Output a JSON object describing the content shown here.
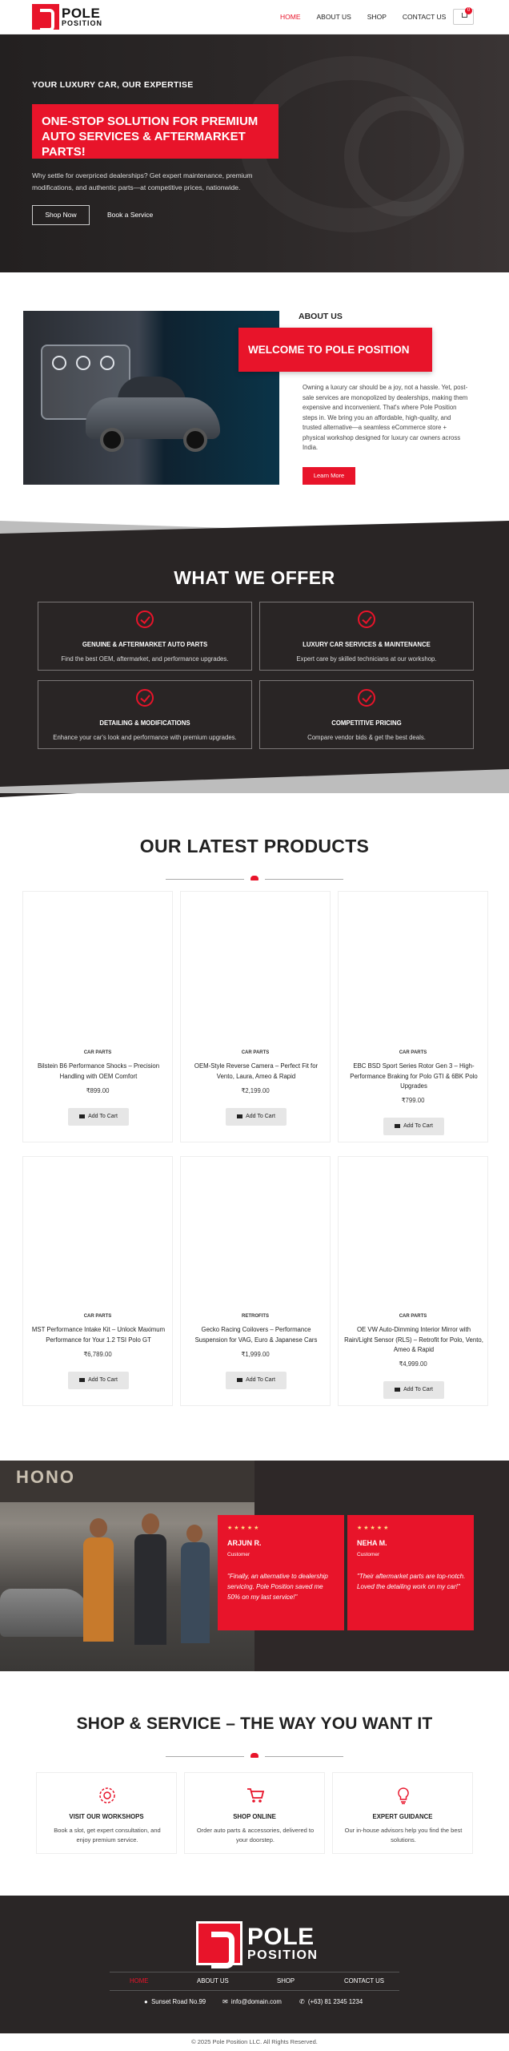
{
  "header": {
    "logo_line1": "POLE",
    "logo_line2": "POSITION",
    "nav": [
      "HOME",
      "ABOUT US",
      "SHOP",
      "CONTACT US"
    ],
    "cart_count": "0"
  },
  "hero": {
    "tagline": "YOUR LUXURY CAR, OUR EXPERTISE",
    "headline": "ONE-STOP SOLUTION FOR PREMIUM AUTO SERVICES & AFTERMARKET PARTS!",
    "subtext": "Why settle for overpriced dealerships? Get expert maintenance, premium modifications, and authentic parts—at competitive prices, nationwide.",
    "btn_shop": "Shop Now",
    "btn_service": "Book a Service"
  },
  "about": {
    "heading": "ABOUT US",
    "welcome": "WELCOME TO POLE POSITION",
    "paragraph": "Owning a luxury car should be a joy, not a hassle. Yet, post-sale services are monopolized by dealerships, making them expensive and inconvenient. That's where Pole Position steps in. We bring you an affordable, high-quality, and trusted alternative—a seamless eCommerce store + physical workshop designed for luxury car owners across India.",
    "btn": "Learn More"
  },
  "offer": {
    "heading": "WHAT WE OFFER",
    "cards": [
      {
        "title": "GENUINE & AFTERMARKET AUTO PARTS",
        "desc": "Find the best OEM, aftermarket, and performance upgrades."
      },
      {
        "title": "LUXURY CAR SERVICES & MAINTENANCE",
        "desc": "Expert care by skilled technicians at our workshop."
      },
      {
        "title": "DETAILING & MODIFICATIONS",
        "desc": "Enhance your car's look and performance with premium upgrades."
      },
      {
        "title": "COMPETITIVE PRICING",
        "desc": "Compare vendor bids & get the best deals."
      }
    ]
  },
  "products": {
    "heading": "OUR LATEST PRODUCTS",
    "add_label": "Add To Cart",
    "items": [
      {
        "cat": "CAR PARTS",
        "name": "Bilstein B6 Performance Shocks – Precision Handling with OEM Comfort",
        "price": "₹899.00"
      },
      {
        "cat": "CAR PARTS",
        "name": "OEM-Style Reverse Camera – Perfect Fit for Vento, Laura, Ameo & Rapid",
        "price": "₹2,199.00"
      },
      {
        "cat": "CAR PARTS",
        "name": "EBC BSD Sport Series Rotor Gen 3 – High-Performance Braking for Polo GTI & 6BK Polo Upgrades",
        "price": "₹799.00"
      },
      {
        "cat": "CAR PARTS",
        "name": "MST Performance Intake Kit – Unlock Maximum Performance for Your 1.2 TSI Polo GT",
        "price": "₹6,789.00"
      },
      {
        "cat": "RETROFITS",
        "name": "Gecko Racing Coilovers – Performance Suspension for VAG, Euro & Japanese Cars",
        "price": "₹1,999.00"
      },
      {
        "cat": "CAR PARTS",
        "name": "OE VW Auto-Dimming Interior Mirror with Rain/Light Sensor (RLS) – Retrofit for Polo, Vento, Ameo & Rapid",
        "price": "₹4,999.00"
      }
    ]
  },
  "testimonials": {
    "sign_text": "HONO",
    "stars": "★★★★★",
    "items": [
      {
        "name": "ARJUN R.",
        "role": "Customer",
        "quote": "\"Finally, an alternative to dealership servicing. Pole Position saved me 50% on my last service!\""
      },
      {
        "name": "NEHA M.",
        "role": "Customer",
        "quote": "\"Their aftermarket parts are top-notch. Loved the detailing work on my car!\""
      }
    ]
  },
  "shopservice": {
    "heading": "SHOP & SERVICE – THE WAY YOU WANT IT",
    "cards": [
      {
        "title": "VISIT OUR WORKSHOPS",
        "desc": "Book a slot, get expert consultation, and enjoy premium service.",
        "icon": "gear-icon"
      },
      {
        "title": "SHOP ONLINE",
        "desc": "Order auto parts & accessories, delivered to your doorstep.",
        "icon": "cart-icon"
      },
      {
        "title": "EXPERT GUIDANCE",
        "desc": "Our in-house advisors help you find the best solutions.",
        "icon": "bulb-icon"
      }
    ]
  },
  "footer": {
    "logo_line1": "POLE",
    "logo_line2": "POSITION",
    "nav": [
      "HOME",
      "ABOUT US",
      "SHOP",
      "CONTACT US"
    ],
    "address": "Sunset Road No.99",
    "email": "info@domain.com",
    "phone": "(+63) 81 2345 1234",
    "copyright": "© 2025 Pole Position LLC. All Rights Reserved."
  },
  "colors": {
    "accent": "#e8142a",
    "dark": "#2a2626"
  }
}
